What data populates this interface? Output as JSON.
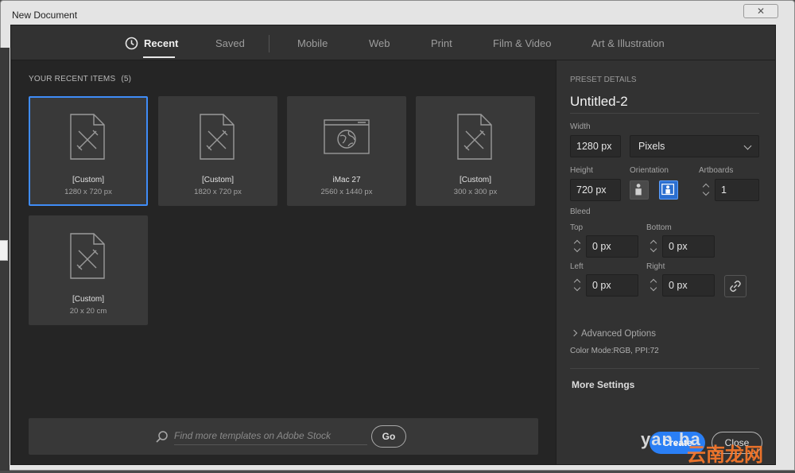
{
  "window": {
    "title": "New Document",
    "close_icon": "close-icon"
  },
  "tabs": [
    {
      "label": "Recent",
      "active": true
    },
    {
      "label": "Saved"
    },
    {
      "label": "Mobile"
    },
    {
      "label": "Web"
    },
    {
      "label": "Print"
    },
    {
      "label": "Film & Video"
    },
    {
      "label": "Art & Illustration"
    }
  ],
  "recent": {
    "heading": "YOUR RECENT ITEMS",
    "count": "(5)",
    "items": [
      {
        "name": "[Custom]",
        "size": "1280 x 720 px",
        "icon": "document-icon",
        "selected": true
      },
      {
        "name": "[Custom]",
        "size": "1820 x 720 px",
        "icon": "document-icon"
      },
      {
        "name": "iMac 27",
        "size": "2560 x 1440 px",
        "icon": "web-icon"
      },
      {
        "name": "[Custom]",
        "size": "300 x 300 px",
        "icon": "document-icon"
      },
      {
        "name": "[Custom]",
        "size": "20 x 20 cm",
        "icon": "document-icon"
      }
    ]
  },
  "search": {
    "placeholder": "Find more templates on Adobe Stock",
    "go_label": "Go"
  },
  "preset": {
    "heading": "PRESET DETAILS",
    "name": "Untitled-2",
    "width_label": "Width",
    "width_value": "1280 px",
    "unit": "Pixels",
    "height_label": "Height",
    "height_value": "720 px",
    "orientation_label": "Orientation",
    "artboards_label": "Artboards",
    "artboards_value": "1",
    "bleed_label": "Bleed",
    "top_label": "Top",
    "top_value": "0 px",
    "bottom_label": "Bottom",
    "bottom_value": "0 px",
    "left_label": "Left",
    "left_value": "0 px",
    "right_label": "Right",
    "right_value": "0 px",
    "advanced_label": "Advanced Options",
    "color_mode": "Color Mode:RGB, PPI:72",
    "more_label": "More Settings",
    "create_label": "Create",
    "close_label": "Close"
  },
  "watermark": {
    "latin": "yan.ba",
    "cn": "云南龙网"
  },
  "colors": {
    "accent": "#2a7ff5",
    "selected_border": "#3f8cf7",
    "dialog_bg": "#252525",
    "panel_bg": "#323232"
  }
}
